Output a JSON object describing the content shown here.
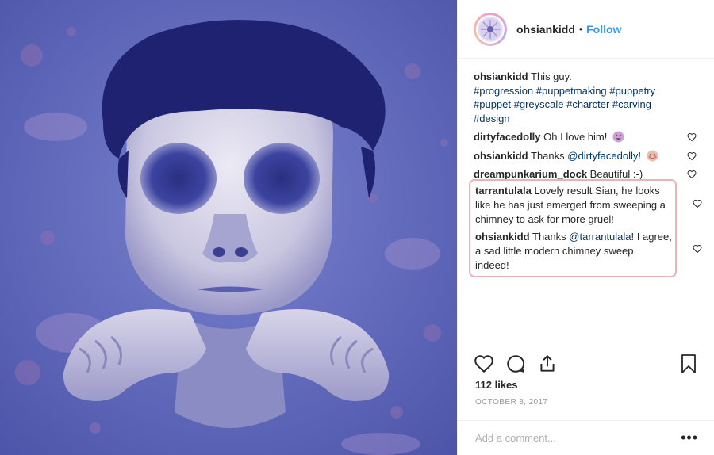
{
  "post": {
    "username": "ohsiankidd",
    "dot": "•",
    "follow_label": "Follow",
    "caption_user": "ohsiankidd",
    "caption_text": "This guy.",
    "hashtags_line1": "#progression #puppetmaking #puppetry",
    "hashtags_line2": "#puppet #greyscale #charcter #carving",
    "hashtags_line3": "#design",
    "likes": "112 likes",
    "date": "OCTOBER 8, 2017",
    "add_comment_placeholder": "Add a comment...",
    "more_label": "•••"
  },
  "comments": [
    {
      "user": "dirtyfacedolly",
      "text": "Oh I love him!"
    },
    {
      "user": "ohsiankidd",
      "text_before": "Thanks",
      "mention": "@dirtyfacedolly!"
    },
    {
      "user": "dreampunkarium_dock",
      "text": "Beautiful :-)"
    },
    {
      "user": "tarrantulala",
      "line1": "Lovely result Sian, he looks",
      "line2": "like he has just emerged from sweeping a",
      "line3": "chimney to ask for more gruel!"
    },
    {
      "user": "ohsiankidd",
      "text_before": "Thanks",
      "mention": "@tarrantulala!",
      "line1_rest": "I agree,",
      "line2": "a sad little modern chimney sweep",
      "line3": "indeed!"
    }
  ],
  "colors": {
    "accent": "#3897f0",
    "highlight_border": "#e8b4b8",
    "media_tint": "#5a63b8"
  },
  "icons": [
    "like-icon",
    "comment-icon",
    "share-icon",
    "bookmark-icon",
    "heart-small-icon"
  ]
}
